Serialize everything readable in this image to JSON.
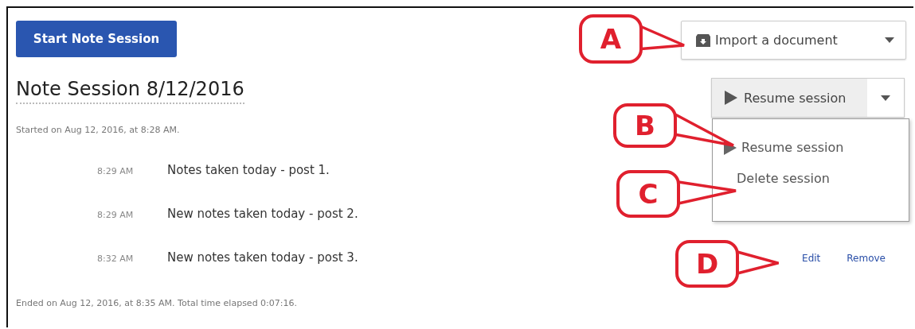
{
  "start_button": "Start Note Session",
  "import_button": {
    "label": "Import a document"
  },
  "session": {
    "title": "Note Session 8/12/2016",
    "started": "Started on Aug 12, 2016, at 8:28 AM.",
    "notes": [
      {
        "time": "8:29 AM",
        "text": "Notes taken today - post 1."
      },
      {
        "time": "8:29 AM",
        "text": "New notes taken today - post 2."
      },
      {
        "time": "8:32 AM",
        "text": "New notes taken today - post 3."
      }
    ],
    "ended": "Ended on Aug 12, 2016, at 8:35 AM. Total time elapsed 0:07:16."
  },
  "resume_button": {
    "label": "Resume session"
  },
  "menu": {
    "items": [
      {
        "kind": "resume",
        "label": "Resume session"
      },
      {
        "kind": "delete",
        "label": "Delete session"
      }
    ]
  },
  "note_actions": [
    "Edit",
    "Remove"
  ],
  "callouts": [
    "A",
    "B",
    "C",
    "D"
  ]
}
